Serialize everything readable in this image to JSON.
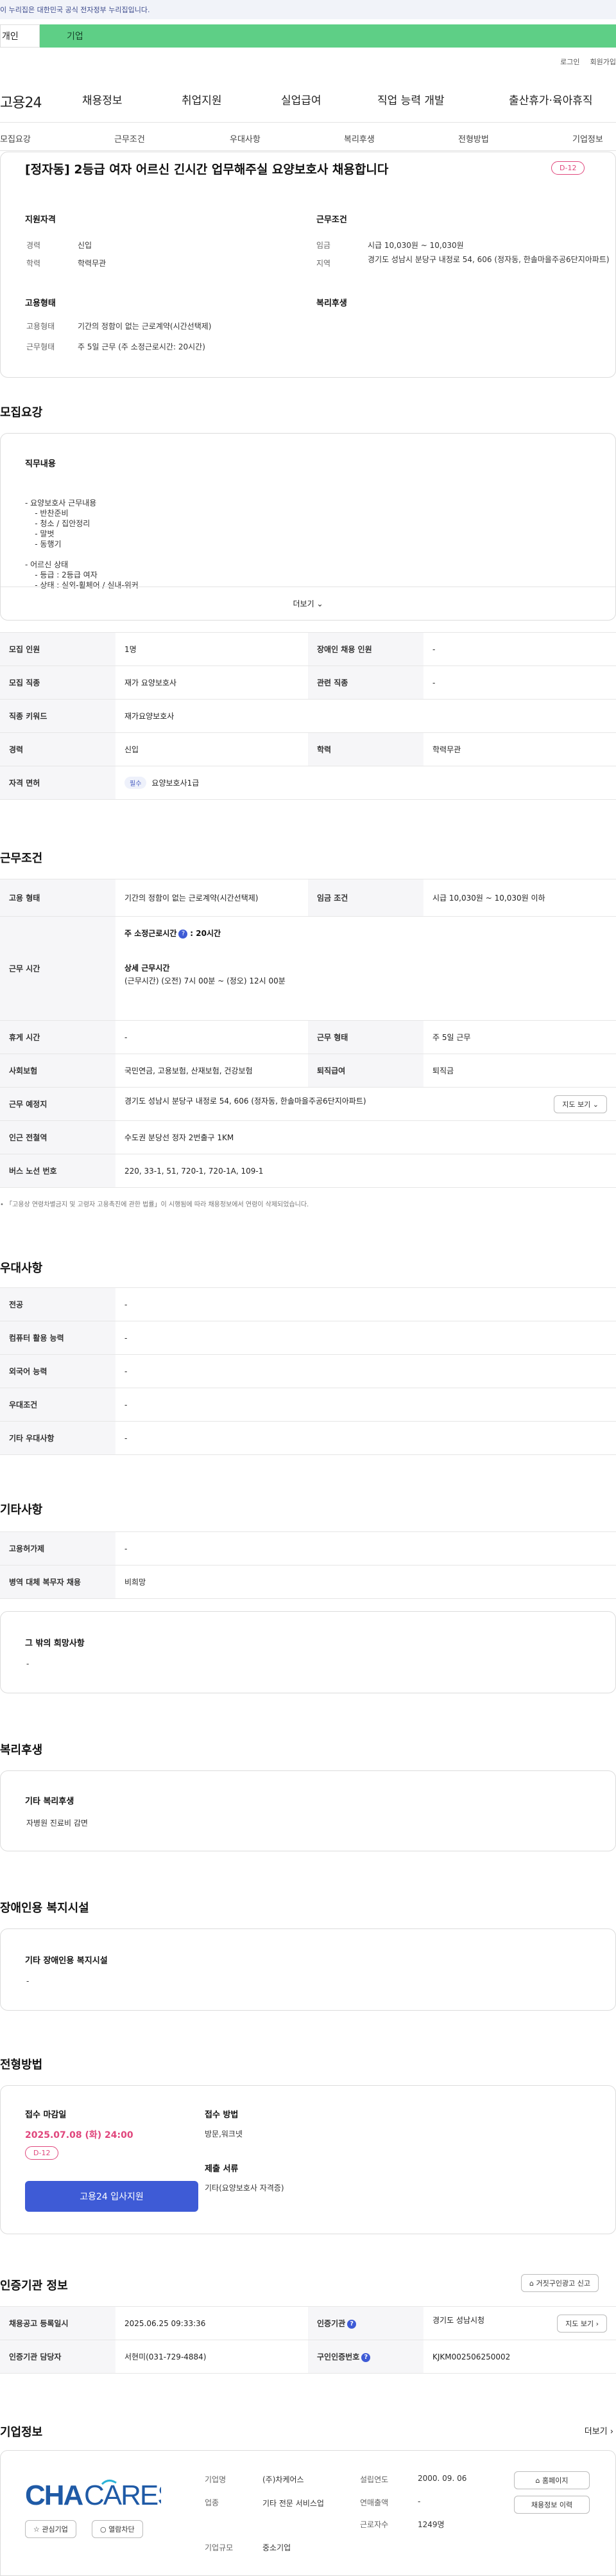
{
  "gov_banner": "이 누리집은 대한민국 공식 전자정부 누리집입니다.",
  "user_tabs": [
    "개인",
    "기업"
  ],
  "util": [
    "로그인",
    "회원가입"
  ],
  "logo": "고용24",
  "gnb": [
    "채용정보",
    "취업지원",
    "실업급여",
    "직업 능력 개발",
    "출산휴가·육아휴직"
  ],
  "anchors": [
    "모집요강",
    "근무조건",
    "우대사항",
    "복리후생",
    "전형방법",
    "기업정보"
  ],
  "summary": {
    "title": "[정자동] 2등급 여자 어르신 긴시간 업무해주실 요양보호사 채용합니다",
    "dday": "D-12",
    "qual_title": "지원자격",
    "cond_title": "근무조건",
    "career_l": "경력",
    "career_v": "신입",
    "edu_l": "학력",
    "edu_v": "학력무관",
    "wage_l": "임금",
    "wage_v": "시급 10,030원 ~ 10,030원",
    "region_l": "지역",
    "region_v": "경기도 성남시 분당구 내정로 54, 606 (정자동, 한솔마을주공6단지아파트)",
    "emp_title": "고용형태",
    "welfare_title": "복리후생",
    "emptype_l": "고용형태",
    "emptype_v": "기간의 정함이 없는 근로계약(시간선택제)",
    "worktype_l": "근무형태",
    "worktype_v": "주 5일 근무 (주 소정근로시간: 20시간)"
  },
  "recruit": {
    "section": "모집요강",
    "job_title": "직무내용",
    "job_lines": [
      "- 요양보호사 근무내용",
      "    - 반찬준비",
      "    - 청소 / 집안정리",
      "    - 말벗",
      "    - 동행기",
      "",
      "- 어르신 상태",
      "    - 등급 : 2등급 여자",
      "    - 상태 : 실외-휠체어 / 실내-워커"
    ],
    "more": "더보기",
    "table": {
      "r1": [
        "모집 인원",
        "1명",
        "장애인 채용 인원",
        "-"
      ],
      "r2": [
        "모집 직종",
        "재가 요양보호사",
        "관련 직종",
        "-"
      ],
      "r3": [
        "직종 키워드",
        "재가요양보호사"
      ],
      "r4": [
        "경력",
        "신입",
        "학력",
        "학력무관"
      ],
      "r5": [
        "자격 면허",
        "필수",
        "요양보호사1급"
      ]
    }
  },
  "conditions": {
    "section": "근무조건",
    "emp_l": "고용 형태",
    "emp_v": "기간의 정함이 없는 근로계약(시간선택제)",
    "wage_l": "임금 조건",
    "wage_v": "시급 10,030원 ~ 10,030원 이하",
    "time_l": "근무 시간",
    "week_hours_l": "주 소정근로시간",
    "week_hours_v": ": 20시간",
    "detail_l": "상세 근무시간",
    "detail_v": "(근무시간) (오전) 7시 00분 ~ (정오) 12시 00분",
    "rest_l": "휴게 시간",
    "rest_v": "-",
    "form_l": "근무 형태",
    "form_v": "주 5일 근무",
    "ins_l": "사회보험",
    "ins_v": "국민연금, 고용보험, 산재보험, 건강보험",
    "ret_l": "퇴직급여",
    "ret_v": "퇴직금",
    "place_l": "근무 예정지",
    "place_v": "경기도 성남시 분당구 내정로 54, 606 (정자동, 한솔마을주공6단지아파트)",
    "map_btn": "지도 보기",
    "subway_l": "인근 전철역",
    "subway_v": "수도권 분당선 정자 2번출구 1KM",
    "bus_l": "버스 노선 번호",
    "bus_v": "220, 33-1, 51, 720-1, 720-1A, 109-1",
    "note": "「고용상 연령차별금지 및 고령자 고용촉진에 관한 법률」이 시행됨에 따라 채용정보에서 연령이 삭제되었습니다."
  },
  "prefer": {
    "section": "우대사항",
    "rows": [
      [
        "전공",
        "-"
      ],
      [
        "컴퓨터 활용 능력",
        "-"
      ],
      [
        "외국어 능력",
        "-"
      ],
      [
        "우대조건",
        "-"
      ],
      [
        "기타 우대사항",
        "-"
      ]
    ]
  },
  "etc": {
    "section": "기타사항",
    "rows": [
      [
        "고용허가제",
        "-"
      ],
      [
        "병역 대체 복무자 채용",
        "비희망"
      ]
    ],
    "other_title": "그 밖의 희망사항",
    "other_v": "-"
  },
  "welfare": {
    "section": "복리후생",
    "title": "기타 복리후생",
    "v": "자병원 진료비 감면"
  },
  "disabled": {
    "section": "장애인용 복지시설",
    "title": "기타 장애인용 복지시설",
    "v": "-"
  },
  "selection": {
    "section": "전형방법",
    "deadline_l": "접수 마감일",
    "deadline_v": "2025.07.08 (화) 24:00",
    "dday": "D-12",
    "apply_btn": "고용24 입사지원",
    "method_l": "접수 방법",
    "method_v": "방문,워크넷",
    "docs_l": "제출 서류",
    "docs_v": "기타(요양보호사 자격증)"
  },
  "cert": {
    "section": "인증기관 정보",
    "report_btn": "거짓구인광고 신고",
    "r1": [
      "채용공고 등록일시",
      "2025.06.25 09:33:36",
      "인증기관",
      "경기도 성남시청"
    ],
    "r2": [
      "인증기관 담당자",
      "서현미(031-729-4884)",
      "구인인증번호",
      "KJKM002506250002"
    ],
    "map_btn": "지도 보기"
  },
  "company": {
    "section": "기업정보",
    "more": "더보기",
    "logo_text": "CHA CARES",
    "interest_btn": "관심기업",
    "block_btn": "열람차단",
    "name_l": "기업명",
    "name_v": "(주)차케어스",
    "industry_l": "업종",
    "industry_v": "기타 전문 서비스업",
    "size_l": "기업규모",
    "size_v": "중소기업",
    "year_l": "설립연도",
    "year_v": "2000. 09. 06",
    "sales_l": "연매출액",
    "sales_v": "-",
    "emp_l": "근로자수",
    "emp_v": "1249명",
    "home_btn": "홈페이지",
    "jobs_btn": "채용정보 이력"
  },
  "colors": {
    "brand": "#5ecf86",
    "accent": "#3e5bd6",
    "dday": "#e0467c"
  }
}
